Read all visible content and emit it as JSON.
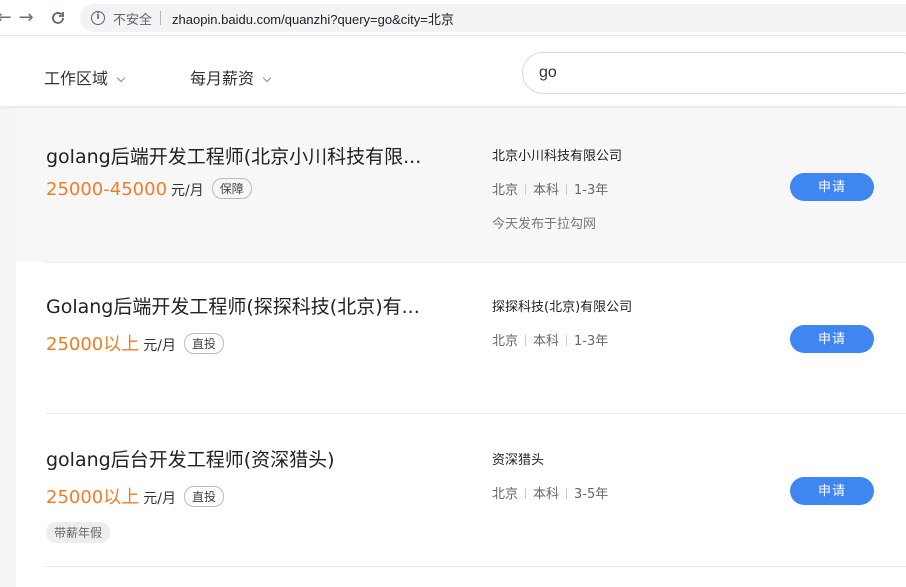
{
  "browser": {
    "security_label": "不安全",
    "url": "zhaopin.baidu.com/quanzhi?query=go&city=北京",
    "back_icon": "arrow-left-icon",
    "forward_icon": "arrow-right-icon",
    "reload_icon": "reload-icon"
  },
  "filters": {
    "area_label": "工作区域",
    "salary_label": "每月薪资",
    "search_value": "go"
  },
  "jobs": [
    {
      "title": "golang后端开发工程师(北京小川科技有限...",
      "salary": "25000-45000",
      "unit": "元/月",
      "tag": "保障",
      "company": "北京小川科技有限公司",
      "city": "北京",
      "education": "本科",
      "experience": "1-3年",
      "source": "今天发布于拉勾网",
      "apply_label": "申请"
    },
    {
      "title": "Golang后端开发工程师(探探科技(北京)有...",
      "salary": "25000以上",
      "unit": "元/月",
      "tag": "直投",
      "company": "探探科技(北京)有限公司",
      "city": "北京",
      "education": "本科",
      "experience": "1-3年",
      "apply_label": "申请"
    },
    {
      "title": "golang后台开发工程师(资深猎头)",
      "salary": "25000以上",
      "unit": "元/月",
      "tag": "直投",
      "welfare": "带薪年假",
      "company": "资深猎头",
      "city": "北京",
      "education": "本科",
      "experience": "3-5年",
      "apply_label": "申请"
    }
  ],
  "colors": {
    "salary": "#ef7d27",
    "apply_button": "#3f86f0"
  }
}
